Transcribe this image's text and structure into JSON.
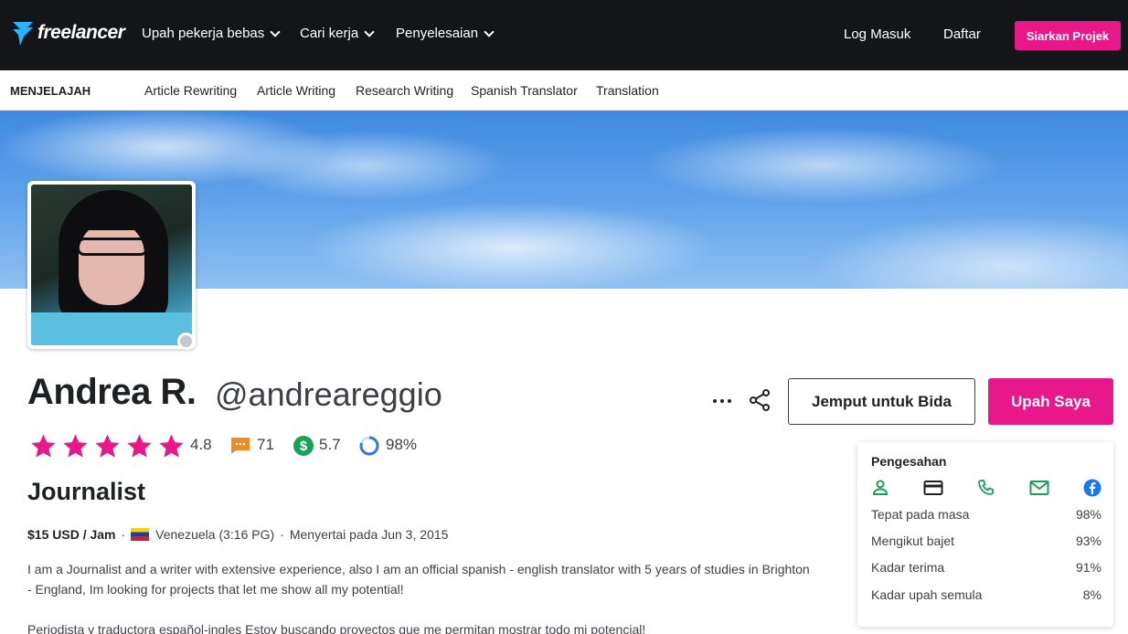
{
  "nav": {
    "logo": "freelancer",
    "links": [
      {
        "label": "Upah pekerja bebas"
      },
      {
        "label": "Cari kerja"
      },
      {
        "label": "Penyelesaian"
      }
    ],
    "login": "Log Masuk",
    "signup": "Daftar",
    "post_project": "Siarkan Projek"
  },
  "explore": {
    "title": "MENJELAJAH",
    "links": [
      "Article Rewriting",
      "Article Writing",
      "Research Writing",
      "Spanish Translator",
      "Translation"
    ]
  },
  "profile": {
    "name": "Andrea R.",
    "username": "@andreareggio",
    "rating": "4.8",
    "stars": 5,
    "reviews": "71",
    "earnings_score": "5.7",
    "completion": "98%",
    "headline": "Journalist",
    "rate": "$15 USD / Jam",
    "location": "Venezuela (3:16 PG)",
    "joined": "Menyertai pada Jun 3, 2015",
    "description": "I am a Journalist and a writer with extensive experience, also I am an official spanish - english translator with 5 years of studies in Brighton - England, Im looking for projects that let me show all my potential!",
    "description_es": "Periodista y traductora español-ingles Estoy buscando proyectos que me permitan mostrar todo mi potencial!"
  },
  "actions": {
    "invite": "Jemput untuk Bida",
    "hire": "Upah Saya"
  },
  "verification": {
    "title": "Pengesahan",
    "icons": [
      "user-icon",
      "credit-card-icon",
      "phone-icon",
      "email-icon",
      "facebook-icon"
    ],
    "stats": [
      {
        "label": "Tepat pada masa",
        "value": "98%"
      },
      {
        "label": "Mengikut bajet",
        "value": "93%"
      },
      {
        "label": "Kadar terima",
        "value": "91%"
      },
      {
        "label": "Kadar upah semula",
        "value": "8%"
      }
    ]
  },
  "colors": {
    "accent": "#e8178a",
    "nav_bg": "#141519",
    "logo_blue": "#29b2fe",
    "star": "#e8178a",
    "review_icon": "#f08a24",
    "earn_icon": "#18a157",
    "comp_icon": "#2f7de1",
    "verify_icon": "#18a157",
    "facebook": "#1877f2"
  }
}
